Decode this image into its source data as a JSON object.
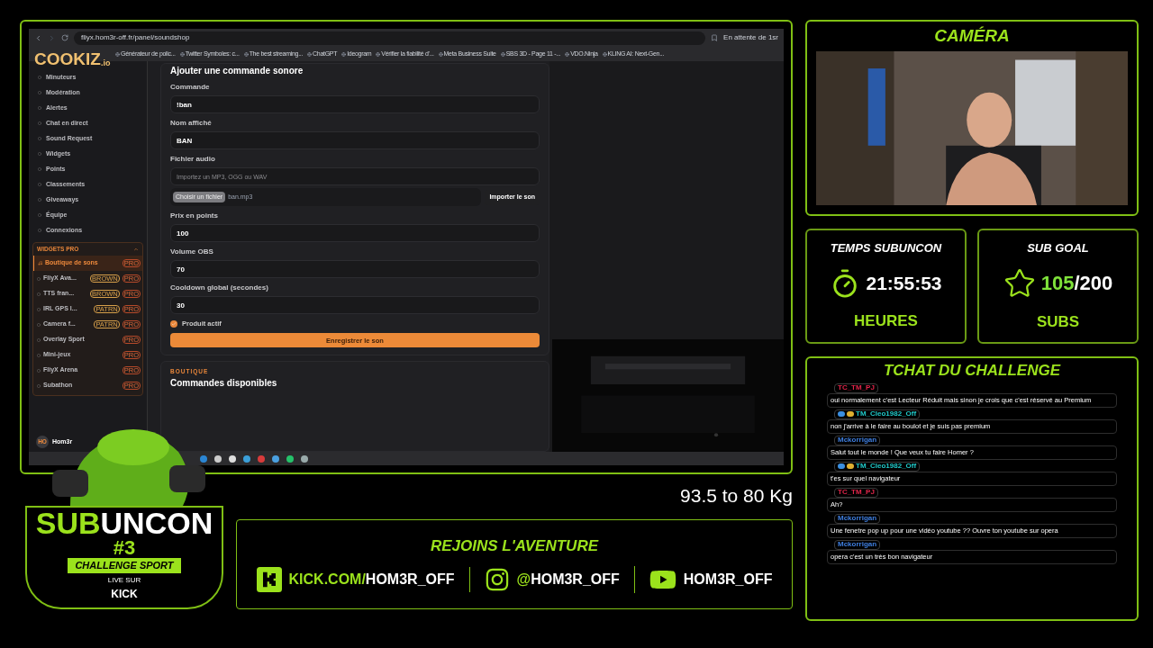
{
  "browser": {
    "url": "fliyx.hom3r-off.fr/panel/soundshop",
    "status": "En attente de 1sr",
    "bookmarks": [
      "Générateur de polic...",
      "Twitter Symboles: c...",
      "The best streaming...",
      "ChatGPT",
      "Ideogram",
      "Vérifier la fiabilité d'...",
      "Meta Business Suite",
      "SBS 3D - Page 11 -...",
      "VDO.Ninja",
      "KLING AI: Next-Gen..."
    ]
  },
  "sponsor": {
    "name": "COOKIZ",
    "suffix": ".io"
  },
  "sidebar": {
    "items": [
      {
        "label": "Minuteurs"
      },
      {
        "label": "Modération"
      },
      {
        "label": "Alertes"
      },
      {
        "label": "Chat en direct"
      },
      {
        "label": "Sound Request"
      },
      {
        "label": "Widgets"
      },
      {
        "label": "Points"
      },
      {
        "label": "Classements"
      },
      {
        "label": "Giveaways"
      },
      {
        "label": "Équipe"
      },
      {
        "label": "Connexions"
      }
    ],
    "section": {
      "title": "WIDGETS PRO",
      "expanded": true,
      "items": [
        {
          "label": "Boutique de sons",
          "selected": true,
          "pro": "PRO"
        },
        {
          "label": "FliyX Ava...",
          "selected": false,
          "tag": "BROWN",
          "pro": "PRO"
        },
        {
          "label": "TTS fran...",
          "selected": false,
          "tag": "BROWN",
          "pro": "PRO"
        },
        {
          "label": "IRL GPS l...",
          "selected": false,
          "tag": "PATRN",
          "pro": "PRO"
        },
        {
          "label": "Camera f...",
          "selected": false,
          "tag": "PATRN",
          "pro": "PRO"
        },
        {
          "label": "Overlay Sport",
          "selected": false,
          "pro": "PRO"
        },
        {
          "label": "Mini-jeux",
          "selected": false,
          "pro": "PRO"
        },
        {
          "label": "FliyX Arena",
          "selected": false,
          "pro": "PRO"
        },
        {
          "label": "Subathon",
          "selected": false,
          "pro": "PRO"
        }
      ]
    },
    "user": {
      "initials": "HO",
      "name": "Hom3r"
    }
  },
  "form": {
    "title": "Ajouter une commande sonore",
    "fields": [
      {
        "label": "Commande",
        "value": "!ban"
      },
      {
        "label": "Nom affiché",
        "value": "BAN"
      }
    ],
    "file": {
      "label": "Fichier audio",
      "placeholder": "Importez un MP3, OGG ou WAV",
      "choose": "Choisir un fichier",
      "filename": "ban.mp3",
      "upload": "Importer le son"
    },
    "fields2": [
      {
        "label": "Prix en points",
        "value": "100"
      },
      {
        "label": "Volume OBS",
        "value": "70"
      },
      {
        "label": "Cooldown global (secondes)",
        "value": "30"
      }
    ],
    "active": {
      "label": "Produit actif",
      "checked": true
    },
    "save": "Enregistrer le son"
  },
  "shop": {
    "eyebrow": "BOUTIQUE",
    "title": "Commandes disponibles"
  },
  "camera": {
    "title": "CAMÉRA"
  },
  "timer": {
    "title": "TEMPS SUBUNCON",
    "value": "21:55:53",
    "unit": "HEURES"
  },
  "subgoal": {
    "title": "SUB GOAL",
    "current": "105",
    "target": "/200",
    "unit": "SUBS"
  },
  "chat": {
    "title": "TCHAT DU CHALLENGE",
    "messages": [
      {
        "user": "TC_TM_PJ",
        "color": "#e0254a",
        "badges": false,
        "text": "oui normalement c'est Lecteur Réduit mais sinon je crois que c'est réservé au Premium"
      },
      {
        "user": "TM_Cleo1982_Off",
        "color": "#20c9c9",
        "badges": true,
        "text": "non j'arrive à le faire au boulot et je suis pas premium"
      },
      {
        "user": "Mckorrigan",
        "color": "#3f7fe0",
        "badges": false,
        "text": "Salut tout le monde ! Que veux tu faire Homer ?"
      },
      {
        "user": "TM_Cleo1982_Off",
        "color": "#20c9c9",
        "badges": true,
        "text": "t'es sur quel navigateur"
      },
      {
        "user": "TC_TM_PJ",
        "color": "#e0254a",
        "badges": false,
        "text": "Ah?"
      },
      {
        "user": "Mckorrigan",
        "color": "#3f7fe0",
        "badges": false,
        "text": "Une fenetre pop up pour une vidéo youtube ?? Ouvre ton youtube sur opera"
      },
      {
        "user": "Mckorrigan",
        "color": "#3f7fe0",
        "badges": false,
        "text": "opera c'est un très bon navigateur"
      }
    ]
  },
  "weight": "93.5 to 80 Kg",
  "socials": {
    "title": "REJOINS L'AVENTURE",
    "links": [
      {
        "kind": "kick",
        "prefix": "KICK.COM/",
        "handle": "HOM3R_OFF"
      },
      {
        "kind": "instagram",
        "prefix": "@",
        "handle": "HOM3R_OFF"
      },
      {
        "kind": "youtube",
        "handle": "HOM3R_OFF"
      }
    ]
  },
  "logo": {
    "name_a": "SUB",
    "name_b": "UNCON",
    "number": "#3",
    "tagline": "CHALLENGE SPORT",
    "live": "LIVE SUR",
    "platform": "KICK"
  }
}
